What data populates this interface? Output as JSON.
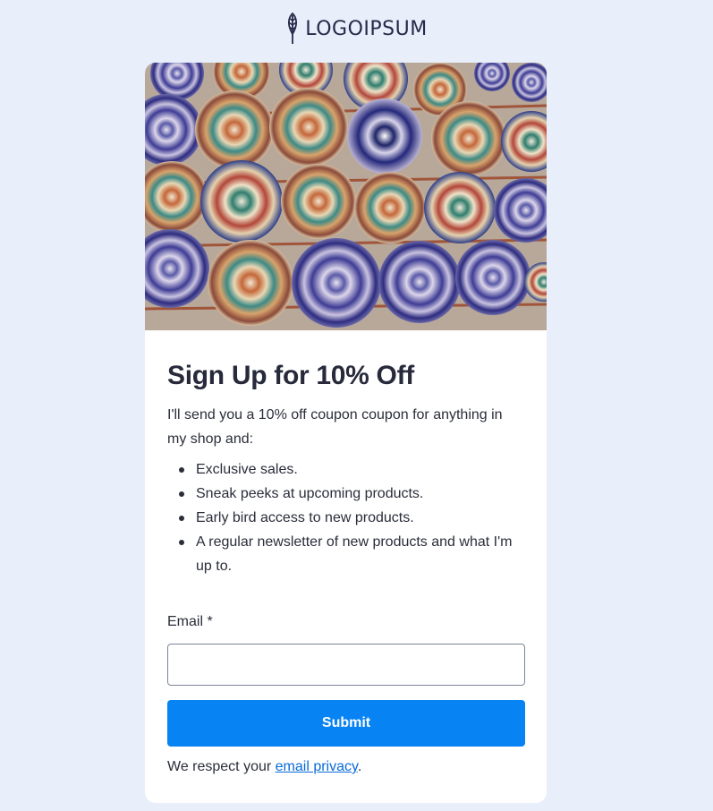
{
  "logo": {
    "text": "LOGOIPSUM",
    "icon": "wheat-leaf-icon",
    "color": "#262a4a"
  },
  "hero": {
    "alt": "Decorative painted ceramic plates hanging on a wall"
  },
  "form": {
    "title": "Sign Up for 10% Off",
    "intro": "I'll send you a 10% off coupon coupon for anything in my shop and:",
    "bullets": [
      "Exclusive sales.",
      "Sneak peeks at upcoming products.",
      "Early bird access to new products.",
      "A regular newsletter of new products and what I'm up to."
    ],
    "email_label": "Email *",
    "email_value": "",
    "email_placeholder": "",
    "submit_label": "Submit",
    "privacy_prefix": "We respect your ",
    "privacy_link": "email privacy",
    "privacy_suffix": "."
  },
  "colors": {
    "page_bg": "#e8eefa",
    "card_bg": "#ffffff",
    "accent": "#0883f4",
    "link": "#0a6ad8"
  }
}
